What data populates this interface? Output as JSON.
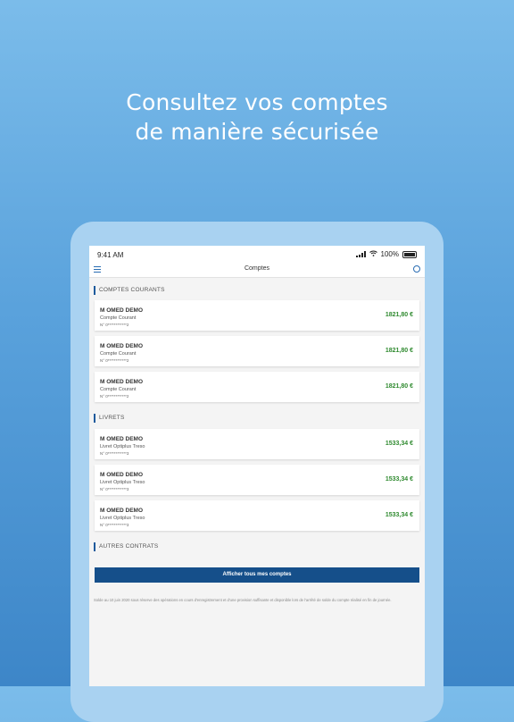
{
  "promo": {
    "line1": "Consultez vos comptes",
    "line2": "de manière sécurisée"
  },
  "status_bar": {
    "time": "9:41 AM",
    "battery": "100%"
  },
  "nav": {
    "title": "Comptes",
    "menu_icon": "hamburger-menu-icon",
    "info_icon": "info-icon"
  },
  "sections": {
    "current": "COMPTES COURANTS",
    "savings": "LIVRETS",
    "other": "AUTRES CONTRATS"
  },
  "current_accounts": [
    {
      "holder": "M OMED DEMO",
      "type": "Compte Courant",
      "number": "N° 0************2",
      "balance": "1821,80 €"
    },
    {
      "holder": "M OMED DEMO",
      "type": "Compte Courant",
      "number": "N° 0************2",
      "balance": "1821,80 €"
    },
    {
      "holder": "M OMED DEMO",
      "type": "Compte Courant",
      "number": "N° 0************2",
      "balance": "1821,80 €"
    }
  ],
  "savings_accounts": [
    {
      "holder": "M OMED DEMO",
      "type": "Livret Optiplus Treso",
      "number": "N° 0************3",
      "balance": "1533,34 €"
    },
    {
      "holder": "M OMED DEMO",
      "type": "Livret Optiplus Treso",
      "number": "N° 0************3",
      "balance": "1533,34 €"
    },
    {
      "holder": "M OMED DEMO",
      "type": "Livret Optiplus Treso",
      "number": "N° 0************3",
      "balance": "1533,34 €"
    }
  ],
  "show_all_label": "Afficher tous mes comptes",
  "footnote": "Solde au 10 juin 2020 sous réserve des opérations en cours d'enregistrement et d'une provision suffisante et disponible lors de l'arrêté de solde du compte réalisé en fin de journée.",
  "colors": {
    "accent": "#154f8a",
    "balance": "#2f8a2f"
  }
}
